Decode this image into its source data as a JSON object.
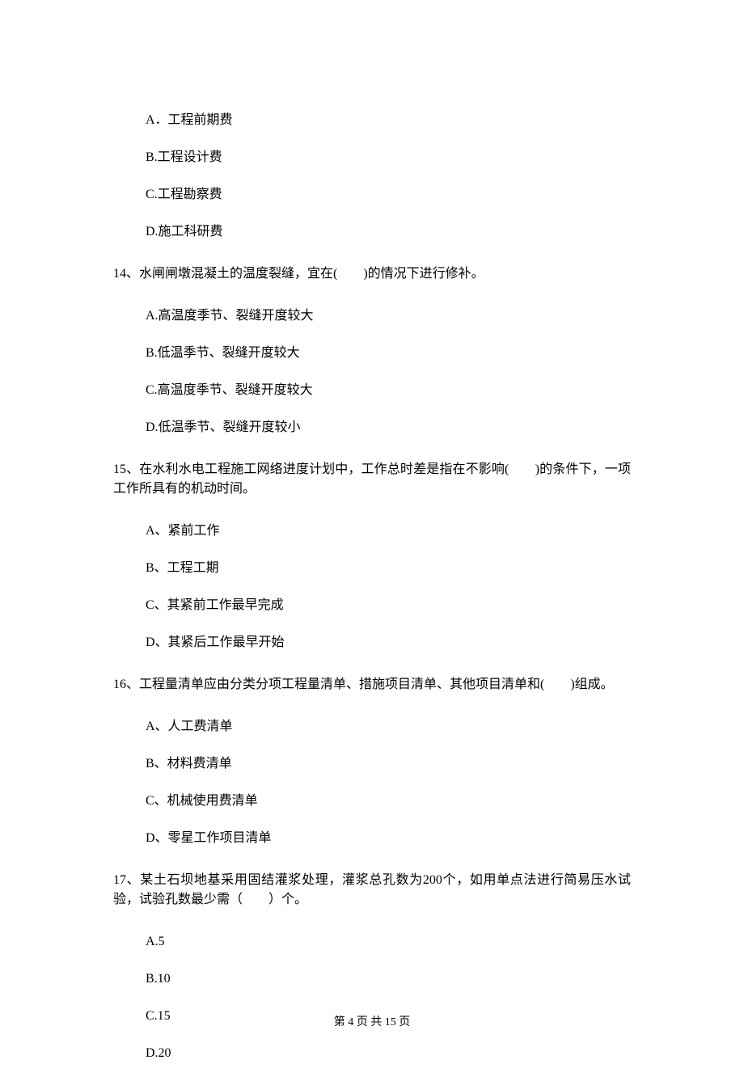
{
  "q13_options": {
    "a": "A．工程前期费",
    "b": "B.工程设计费",
    "c": "C.工程勘察费",
    "d": "D.施工科研费"
  },
  "q14": {
    "stem": "14、水闸闸墩混凝土的温度裂缝，宜在(　　)的情况下进行修补。",
    "options": {
      "a": "A.高温度季节、裂缝开度较大",
      "b": "B.低温季节、裂缝开度较大",
      "c": "C.高温度季节、裂缝开度较大",
      "d": "D.低温季节、裂缝开度较小"
    }
  },
  "q15": {
    "stem": "15、在水利水电工程施工网络进度计划中，工作总时差是指在不影响(　　)的条件下，一项工作所具有的机动时间。",
    "options": {
      "a": "A、紧前工作",
      "b": "B、工程工期",
      "c": "C、其紧前工作最早完成",
      "d": "D、其紧后工作最早开始"
    }
  },
  "q16": {
    "stem": "16、工程量清单应由分类分项工程量清单、措施项目清单、其他项目清单和(　　)组成。",
    "options": {
      "a": "A、人工费清单",
      "b": "B、材料费清单",
      "c": "C、机械使用费清单",
      "d": "D、零星工作项目清单"
    }
  },
  "q17": {
    "stem": "17、某土石坝地基采用固结灌浆处理，灌浆总孔数为200个，如用单点法进行简易压水试验，试验孔数最少需（　　）个。",
    "options": {
      "a": "A.5",
      "b": "B.10",
      "c": "C.15",
      "d": "D.20"
    }
  },
  "footer": "第 4 页 共 15 页"
}
